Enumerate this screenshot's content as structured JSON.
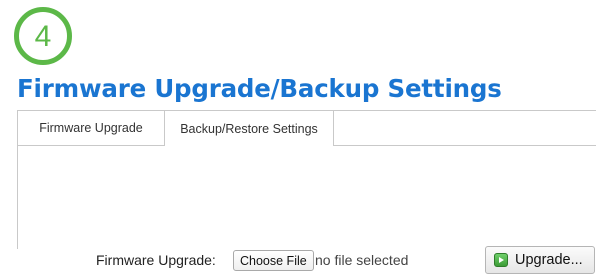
{
  "step_badge": {
    "number": "4",
    "color": "#5cb848"
  },
  "page": {
    "title": "Firmware Upgrade/Backup Settings",
    "title_color": "#1a75d1"
  },
  "tabs": [
    {
      "label": "Firmware Upgrade",
      "active": false
    },
    {
      "label": "Backup/Restore Settings",
      "active": true
    }
  ],
  "form": {
    "firmware_upgrade": {
      "label": "Firmware Upgrade:",
      "choose_file_label": "Choose File",
      "file_status": "no file selected",
      "upgrade_button_label": "Upgrade...",
      "upgrade_icon": "play-icon"
    }
  }
}
